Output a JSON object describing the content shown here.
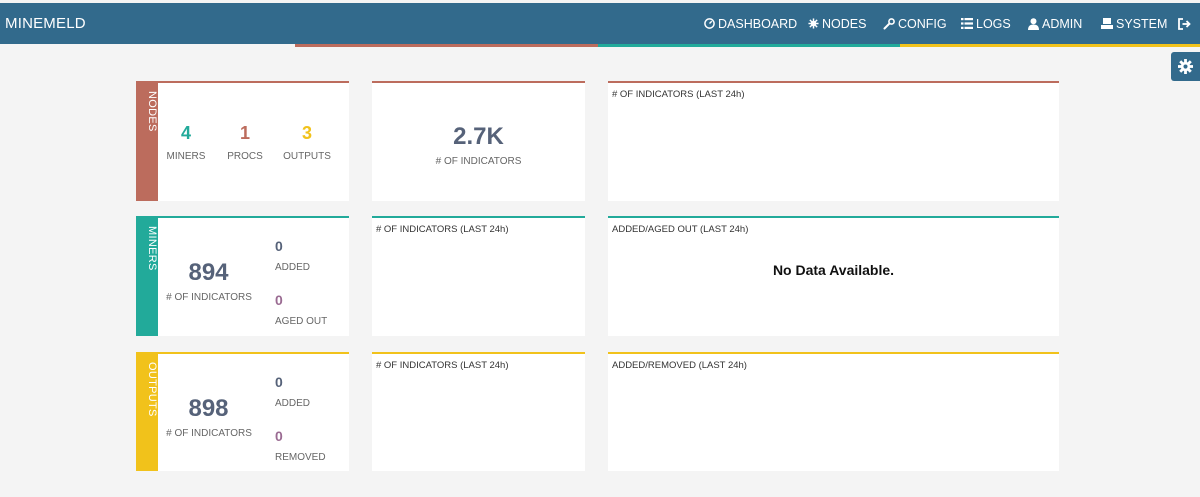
{
  "navbar": {
    "brand": "MINEMELD",
    "items": [
      {
        "label": "DASHBOARD",
        "icon": "dashboard-icon"
      },
      {
        "label": "NODES",
        "icon": "nodes-icon"
      },
      {
        "label": "CONFIG",
        "icon": "wrench-icon"
      },
      {
        "label": "LOGS",
        "icon": "list-icon"
      },
      {
        "label": "ADMIN",
        "icon": "user-icon"
      },
      {
        "label": "SYSTEM",
        "icon": "system-icon"
      }
    ],
    "logout_icon": "logout-icon"
  },
  "colors": {
    "navbar": "#326a8c",
    "nodes": "#bc6c5d",
    "miners": "#22aa9a",
    "outputs": "#f1c21b",
    "stat_dark": "#566279",
    "stat_purple": "#9a6b92"
  },
  "settings_icon": "gear-icon",
  "nodes": {
    "tab": "NODES",
    "miners_count": "4",
    "miners_label": "MINERS",
    "procs_count": "1",
    "procs_label": "PROCS",
    "outputs_count": "3",
    "outputs_label": "OUTPUTS",
    "total_value": "2.7K",
    "total_label": "# OF INDICATORS",
    "chart_title": "# OF INDICATORS (LAST 24h)"
  },
  "miners": {
    "tab": "MINERS",
    "indicators": "894",
    "indicators_label": "# OF INDICATORS",
    "added": "0",
    "added_label": "ADDED",
    "aged_out": "0",
    "aged_out_label": "AGED OUT",
    "chart1_title": "# OF INDICATORS (LAST 24h)",
    "chart2_title": "ADDED/AGED OUT (LAST 24h)",
    "no_data": "No Data Available."
  },
  "outputs": {
    "tab": "OUTPUTS",
    "indicators": "898",
    "indicators_label": "# OF INDICATORS",
    "added": "0",
    "added_label": "ADDED",
    "removed": "0",
    "removed_label": "REMOVED",
    "chart1_title": "# OF INDICATORS (LAST 24h)",
    "chart2_title": "ADDED/REMOVED (LAST 24h)"
  }
}
